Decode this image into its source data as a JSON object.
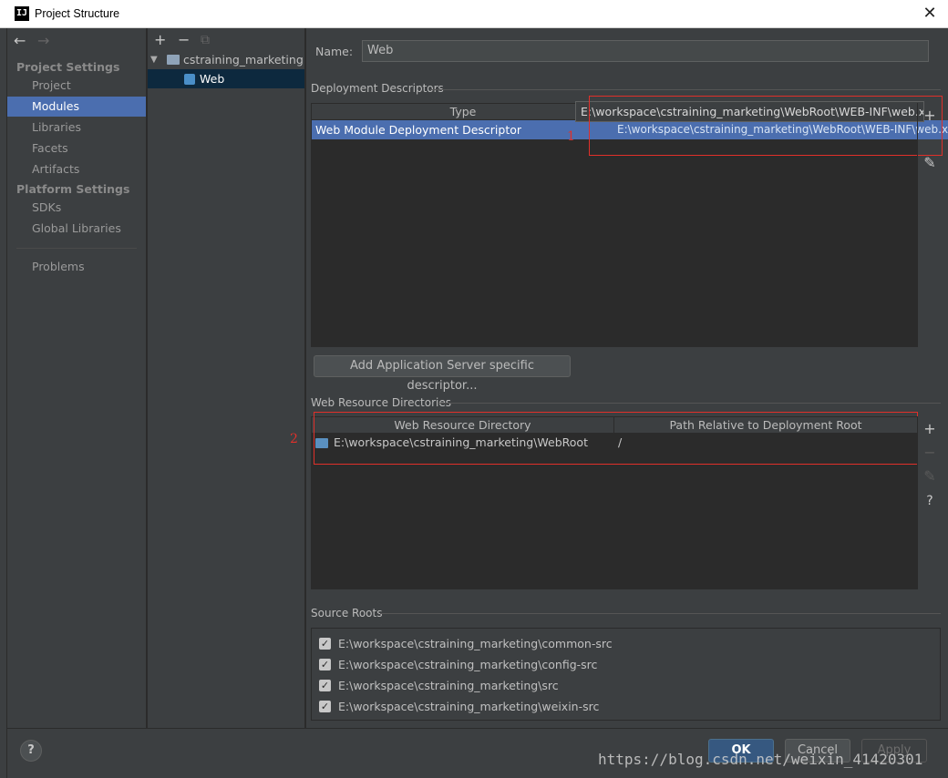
{
  "window": {
    "title": "Project Structure",
    "icon_text": "IJ",
    "close_glyph": "✕"
  },
  "sidebar": {
    "back_glyph": "←",
    "forward_glyph": "→",
    "section_project": "Project Settings",
    "items_project": [
      "Project",
      "Modules",
      "Libraries",
      "Facets",
      "Artifacts"
    ],
    "section_platform": "Platform Settings",
    "items_platform": [
      "SDKs",
      "Global Libraries"
    ],
    "problems": "Problems",
    "selected": "Modules"
  },
  "tree": {
    "add": "+",
    "remove": "−",
    "copy": "⧉",
    "root": "cstraining_marketing",
    "child": "Web"
  },
  "main": {
    "name_label": "Name:",
    "name_value": "Web",
    "deploy_title": "Deployment Descriptors",
    "deploy_col_type": "Type",
    "deploy_tooltip": "E:\\workspace\\cstraining_marketing\\WebRoot\\WEB-INF\\web.xml",
    "deploy_row_type": "Web Module Deployment Descriptor",
    "deploy_row_path": "E:\\workspace\\cstraining_marketing\\WebRoot\\WEB-INF\\web.xml",
    "mark1": "1",
    "add_server_btn": "Add Application Server specific descriptor...",
    "webres_title": "Web Resource Directories",
    "webres_col1": "Web Resource Directory",
    "webres_col2": "Path Relative to Deployment Root",
    "webres_row_dir": "E:\\workspace\\cstraining_marketing\\WebRoot",
    "webres_row_path": "/",
    "mark2": "2",
    "source_title": "Source Roots",
    "source_roots": [
      "E:\\workspace\\cstraining_marketing\\common-src",
      "E:\\workspace\\cstraining_marketing\\config-src",
      "E:\\workspace\\cstraining_marketing\\src",
      "E:\\workspace\\cstraining_marketing\\weixin-src"
    ],
    "side_add": "+",
    "side_remove": "−",
    "side_edit": "✎",
    "side_help": "?",
    "check_glyph": "✓"
  },
  "footer": {
    "help": "?",
    "ok": "OK",
    "cancel": "Cancel",
    "apply": "Apply",
    "watermark": "https://blog.csdn.net/weixin_41420301"
  }
}
